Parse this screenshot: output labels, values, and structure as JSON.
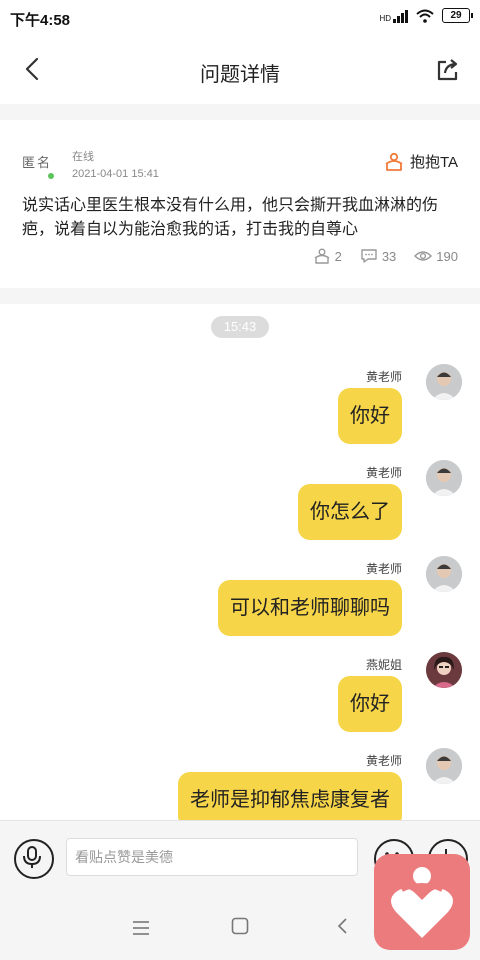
{
  "status_bar": {
    "time": "下午4:58",
    "network": "HD",
    "battery": "29"
  },
  "header": {
    "title": "问题详情"
  },
  "question": {
    "author": "匿名",
    "online_status": "在线",
    "date": "2021-04-01 15:41",
    "hug_label": "抱抱TA",
    "text": "说实话心里医生根本没有什么用，他只会撕开我血淋淋的伤疤，说着自以为能治愈我的话，打击我的自尊心",
    "hugs": "2",
    "comments": "33",
    "views": "190"
  },
  "chat": {
    "time_divider": "15:43",
    "messages": [
      {
        "sender": "黄老师",
        "text": "你好"
      },
      {
        "sender": "黄老师",
        "text": "你怎么了"
      },
      {
        "sender": "黄老师",
        "text": "可以和老师聊聊吗"
      },
      {
        "sender": "燕妮姐",
        "text": "你好"
      },
      {
        "sender": "黄老师",
        "text": "老师是抑郁焦虑康复者"
      }
    ]
  },
  "input": {
    "placeholder": "看贴点赞是美德"
  },
  "colors": {
    "bubble": "#f7d549",
    "hug_accent": "#f07a3a",
    "logo": "#ec7b7d",
    "online": "#5cc45a"
  },
  "icons": [
    "back-icon",
    "share-icon",
    "hug-icon",
    "hug-count-icon",
    "comment-icon",
    "eye-icon",
    "microphone-icon",
    "emoji-icon",
    "plus-icon",
    "menu-icon",
    "home-icon",
    "nav-back-icon",
    "app-logo-icon"
  ]
}
